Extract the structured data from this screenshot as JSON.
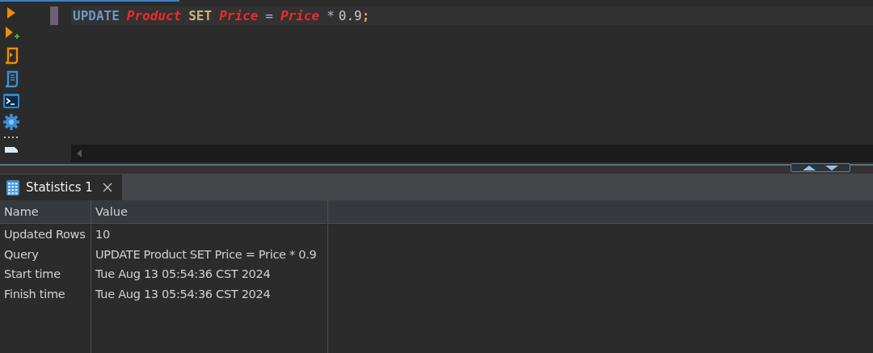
{
  "editor": {
    "line": [
      {
        "text": "UPDATE",
        "kind": "keyword"
      },
      {
        "text": "Product",
        "kind": "identifier"
      },
      {
        "text": "SET",
        "kind": "clause"
      },
      {
        "text": "Price",
        "kind": "identifier"
      },
      {
        "text": "=",
        "kind": "operator"
      },
      {
        "text": "Price",
        "kind": "identifier"
      },
      {
        "text": "*",
        "kind": "operator"
      },
      {
        "text": "0.9",
        "kind": "number"
      },
      {
        "text": ";",
        "kind": "punct"
      }
    ]
  },
  "result_tabs": [
    {
      "label": "Statistics 1",
      "selected": true
    }
  ],
  "table": {
    "columns": [
      "Name",
      "Value"
    ],
    "rows": [
      {
        "name": "Updated Rows",
        "value": "10"
      },
      {
        "name": "Query",
        "value": "UPDATE Product SET Price = Price * 0.9"
      },
      {
        "name": "Start time",
        "value": "Tue Aug 13 05:54:36 CST 2024"
      },
      {
        "name": "Finish time",
        "value": "Tue Aug 13 05:54:36 CST 2024"
      }
    ]
  }
}
